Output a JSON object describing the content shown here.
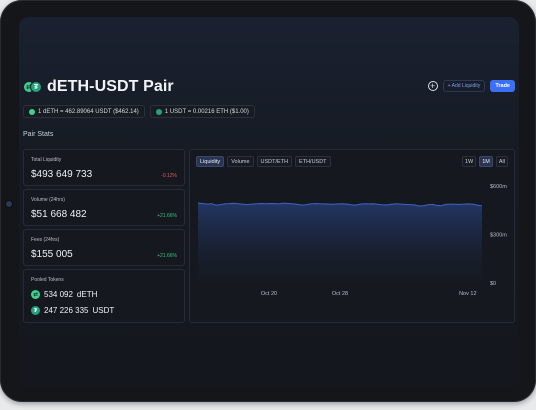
{
  "header": {
    "title": "dETH-USDT Pair",
    "add_liquidity": "+ Add Liquidity",
    "trade": "Trade",
    "plus_icon": "plus-circle-icon"
  },
  "rates": [
    {
      "text": "1 dETH = 462.89064 USDT ($462.14)"
    },
    {
      "text": "1 USDT = 0.00216 ETH ($1.00)"
    }
  ],
  "section_title": "Pair Stats",
  "stats": {
    "total_liquidity": {
      "label": "Total Liquidity",
      "value": "$493 649 733",
      "change": "-0.12%"
    },
    "volume": {
      "label": "Volume (24hrs)",
      "value": "$51 668 482",
      "change": "+21.66%"
    },
    "fees": {
      "label": "Fees (24hrs)",
      "value": "$155 005",
      "change": "+21.66%"
    }
  },
  "pooled": {
    "label": "Pooled Tokens",
    "tokens": [
      {
        "amount": "534 092",
        "symbol": "dETH"
      },
      {
        "amount": "247 226 335",
        "symbol": "USDT"
      }
    ]
  },
  "chart_tabs": [
    "Liquidity",
    "Volume",
    "USDT/ETH",
    "ETH/USDT"
  ],
  "chart_ranges": [
    "1W",
    "1M",
    "All"
  ],
  "chart_data": {
    "type": "area",
    "x_ticks": [
      "Oct 20",
      "Oct 28",
      "Nov 12"
    ],
    "y_ticks": [
      "$600m",
      "$300m",
      "$0"
    ],
    "ylim": [
      0,
      600
    ],
    "values": [
      495,
      492,
      488,
      490,
      482,
      485,
      490,
      491,
      493,
      490,
      487,
      485,
      488,
      490,
      492,
      490,
      492,
      491,
      489,
      494,
      492,
      490,
      486,
      482,
      484,
      489,
      491,
      490,
      489,
      488,
      487,
      489,
      490,
      488,
      484,
      482,
      488,
      490,
      489,
      490,
      486,
      484,
      483,
      487,
      490,
      488,
      486,
      485,
      483,
      476,
      478,
      484,
      486,
      480,
      478,
      486,
      488,
      487,
      486,
      488,
      489,
      487,
      482,
      477
    ]
  },
  "colors": {
    "accent": "#3b6ff5",
    "line": "#3d63c4",
    "negative": "#e05b5b",
    "positive": "#39c37a"
  }
}
